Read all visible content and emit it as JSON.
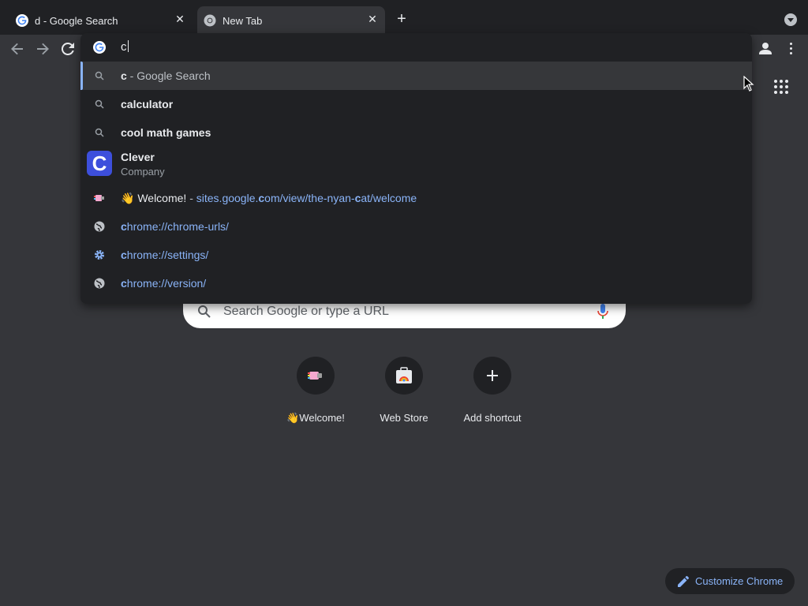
{
  "tabs": [
    {
      "title": "d - Google Search",
      "icon": "google-g-icon",
      "close": "✕",
      "active": false
    },
    {
      "title": "New Tab",
      "icon": "chrome-icon",
      "close": "✕",
      "active": true
    }
  ],
  "new_tab_symbol": "+",
  "omnibox": {
    "input_value": "c",
    "suggestions": [
      {
        "type": "search",
        "bold": "c",
        "rest": " - Google Search",
        "icon": "search-icon"
      },
      {
        "type": "search",
        "bold": "calculator",
        "icon": "search-icon"
      },
      {
        "type": "search",
        "bold": "cool math games",
        "icon": "search-icon"
      },
      {
        "type": "entity",
        "title": "Clever",
        "subtitle": "Company",
        "image_letter": "C"
      },
      {
        "type": "url",
        "emoji": "👋",
        "title": " Welcome!",
        "sep": " - ",
        "url_pre": "sites.google.",
        "url_b1": "c",
        "url_mid": "om/view/the-nyan-",
        "url_b2": "c",
        "url_post": "at/welcome",
        "icon": "nyan-cat-icon"
      },
      {
        "type": "url",
        "url_b": "c",
        "url_rest": "hrome://chrome-urls/",
        "icon": "globe-icon"
      },
      {
        "type": "url",
        "url_b": "c",
        "url_rest": "hrome://settings/",
        "icon": "settings-icon"
      },
      {
        "type": "url",
        "url_b": "c",
        "url_rest": "hrome://version/",
        "icon": "globe-icon"
      }
    ]
  },
  "ntp": {
    "search_placeholder": "Search Google or type a URL",
    "shortcuts": [
      {
        "label": "👋Welcome!",
        "icon": "nyan-cat-icon"
      },
      {
        "label": "Web Store",
        "icon": "web-store-icon"
      },
      {
        "label": "Add shortcut",
        "icon": "plus-icon"
      }
    ],
    "customize_label": "Customize Chrome"
  },
  "colors": {
    "accent": "#8ab4f8",
    "background": "#35363a",
    "popup": "#202124"
  }
}
